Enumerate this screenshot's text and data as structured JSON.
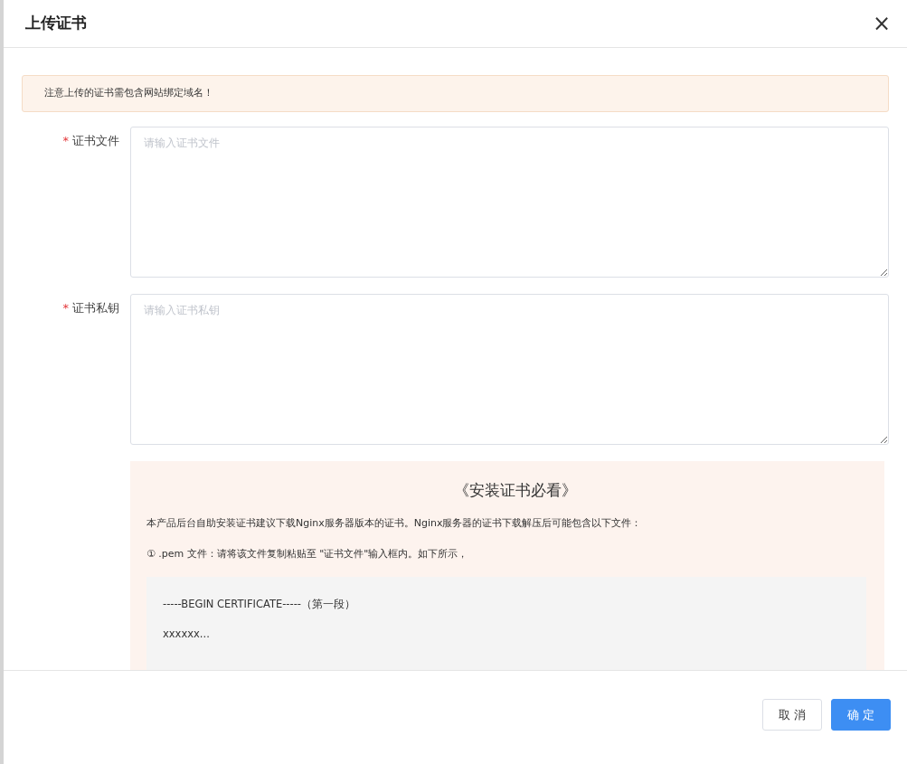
{
  "dialog": {
    "title": "上传证书",
    "close": "×"
  },
  "notice": "注意上传的证书需包含网站绑定域名！",
  "fields": [
    {
      "label": "证书文件",
      "required": true,
      "required_mark": "*",
      "placeholder": "请输入证书文件"
    },
    {
      "label": "证书私钥",
      "required": true,
      "required_mark": "*",
      "placeholder": "请输入证书私钥"
    }
  ],
  "guide": {
    "title": "《安装证书必看》",
    "paragraphs": [
      "本产品后台自助安装证书建议下载Nginx服务器版本的证书。Nginx服务器的证书下载解压后可能包含以下文件：",
      "① .pem 文件：请将该文件复制粘贴至 \"证书文件\"输入框内。如下所示，"
    ],
    "code_lines": [
      "-----BEGIN CERTIFICATE-----（第一段）",
      "xxxxxx..."
    ]
  },
  "buttons": [
    {
      "label": "取 消",
      "kind": "secondary"
    },
    {
      "label": "确 定",
      "kind": "primary"
    }
  ]
}
